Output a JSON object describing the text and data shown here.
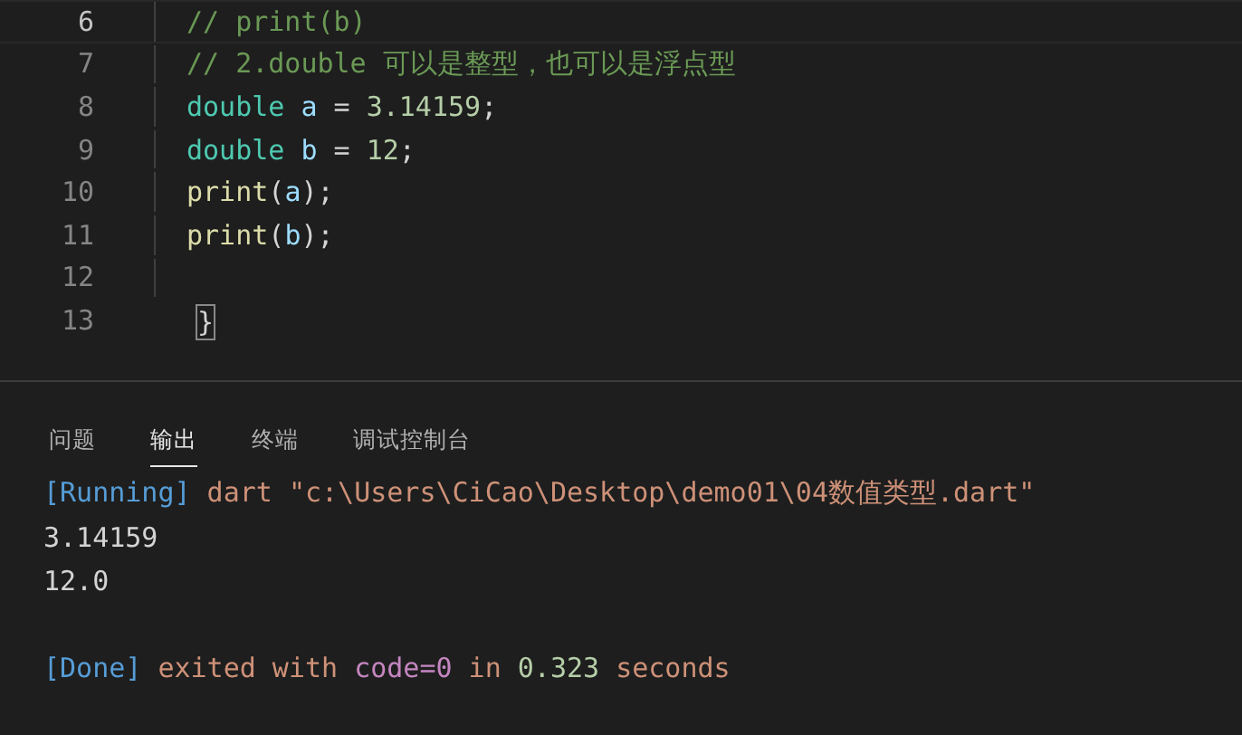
{
  "editor": {
    "lines": [
      {
        "number": "6",
        "current": true,
        "tokens": [
          {
            "kind": "comment",
            "text": "// print(b)"
          }
        ]
      },
      {
        "number": "7",
        "current": false,
        "tokens": [
          {
            "kind": "comment",
            "text": "// 2.double 可以是整型，也可以是浮点型"
          }
        ]
      },
      {
        "number": "8",
        "current": false,
        "tokens": [
          {
            "kind": "type",
            "text": "double "
          },
          {
            "kind": "variable",
            "text": "a"
          },
          {
            "kind": "plain",
            "text": " = "
          },
          {
            "kind": "number",
            "text": "3.14159"
          },
          {
            "kind": "plain",
            "text": ";"
          }
        ]
      },
      {
        "number": "9",
        "current": false,
        "tokens": [
          {
            "kind": "type",
            "text": "double "
          },
          {
            "kind": "variable",
            "text": "b"
          },
          {
            "kind": "plain",
            "text": " = "
          },
          {
            "kind": "number",
            "text": "12"
          },
          {
            "kind": "plain",
            "text": ";"
          }
        ]
      },
      {
        "number": "10",
        "current": false,
        "tokens": [
          {
            "kind": "function",
            "text": "print"
          },
          {
            "kind": "plain",
            "text": "("
          },
          {
            "kind": "variable",
            "text": "a"
          },
          {
            "kind": "plain",
            "text": ");"
          }
        ]
      },
      {
        "number": "11",
        "current": false,
        "tokens": [
          {
            "kind": "function",
            "text": "print"
          },
          {
            "kind": "plain",
            "text": "("
          },
          {
            "kind": "variable",
            "text": "b"
          },
          {
            "kind": "plain",
            "text": ");"
          }
        ]
      },
      {
        "number": "12",
        "current": false
      },
      {
        "number": "13",
        "current": false,
        "tokens": [
          {
            "kind": "bracket",
            "text": "}"
          }
        ]
      }
    ]
  },
  "panel": {
    "tabs": [
      {
        "label": "问题",
        "selected": false
      },
      {
        "label": "输出",
        "selected": true
      },
      {
        "label": "终端",
        "selected": false
      },
      {
        "label": "调试控制台",
        "selected": false
      }
    ],
    "output": [
      {
        "blank_line_before": false,
        "tokens": [
          {
            "kind": "tag",
            "text": "[Running]"
          },
          {
            "kind": "string",
            "text": " dart \"c:\\Users\\CiCao\\Desktop\\demo01\\04数值类型.dart\""
          }
        ]
      },
      {
        "blank_line_before": false,
        "tokens": [
          {
            "kind": "plain",
            "text": "3.14159"
          }
        ]
      },
      {
        "blank_line_before": false,
        "tokens": [
          {
            "kind": "plain",
            "text": "12.0"
          }
        ]
      },
      {
        "blank_line_before": true,
        "tokens": [
          {
            "kind": "tag",
            "text": "[Done]"
          },
          {
            "kind": "string",
            "text": " exited with "
          },
          {
            "kind": "keyword",
            "text": "code=0"
          },
          {
            "kind": "string",
            "text": " in "
          },
          {
            "kind": "number",
            "text": "0.323"
          },
          {
            "kind": "string",
            "text": " seconds"
          }
        ]
      }
    ]
  }
}
